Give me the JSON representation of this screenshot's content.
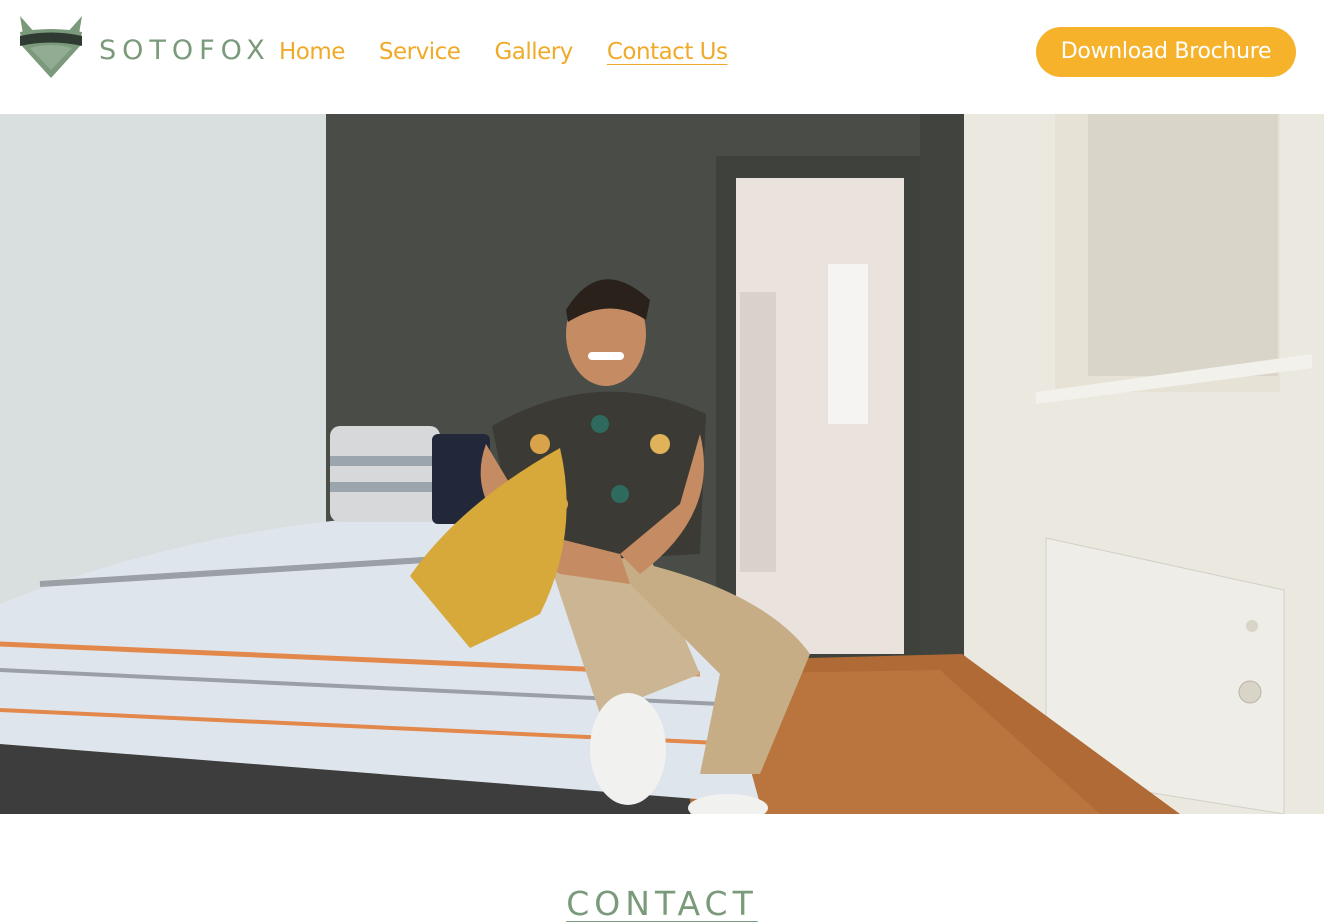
{
  "header": {
    "brand": "SOTOFOX",
    "nav": [
      {
        "label": "Home",
        "active": false
      },
      {
        "label": "Service",
        "active": false
      },
      {
        "label": "Gallery",
        "active": false
      },
      {
        "label": "Contact Us",
        "active": true
      }
    ],
    "cta_label": "Download Brochure"
  },
  "hero": {
    "icon": "hero-photo"
  },
  "contact": {
    "heading": "CONTACT"
  },
  "colors": {
    "brand_green": "#7a9a7b",
    "accent_orange": "#f0aa2a",
    "cta_background": "#f7b22c"
  }
}
